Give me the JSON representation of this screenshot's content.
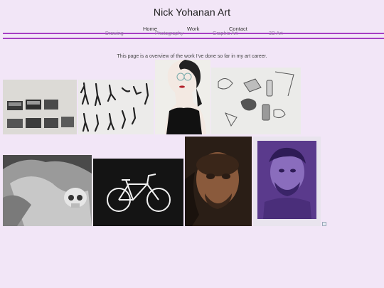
{
  "site": {
    "title": "Nick Yohanan Art"
  },
  "nav": {
    "items": [
      "Home",
      "Work",
      "Contact"
    ]
  },
  "subnav": {
    "items": [
      "Drawing",
      "Photography",
      "Graphic Art",
      "3D Art"
    ]
  },
  "intro": {
    "text": "This page is a overview of the work I've done so far in my art career."
  },
  "colors": {
    "background": "#f2e6f7",
    "accent_line": "#a63fc4"
  },
  "gallery": {
    "items": [
      {
        "name": "art-photo-frames",
        "icon": "artwork-image"
      },
      {
        "name": "art-figure-sketches",
        "icon": "artwork-image"
      },
      {
        "name": "art-woman-portrait",
        "icon": "artwork-image"
      },
      {
        "name": "art-still-life-objects",
        "icon": "artwork-image"
      },
      {
        "name": "art-skull-drapery",
        "icon": "artwork-image"
      },
      {
        "name": "art-bicycle",
        "icon": "artwork-image"
      },
      {
        "name": "art-man-portrait-dark",
        "icon": "artwork-image"
      },
      {
        "name": "art-man-portrait-purple",
        "icon": "artwork-image"
      },
      {
        "name": "broken-image",
        "icon": "broken-image-icon"
      }
    ]
  }
}
